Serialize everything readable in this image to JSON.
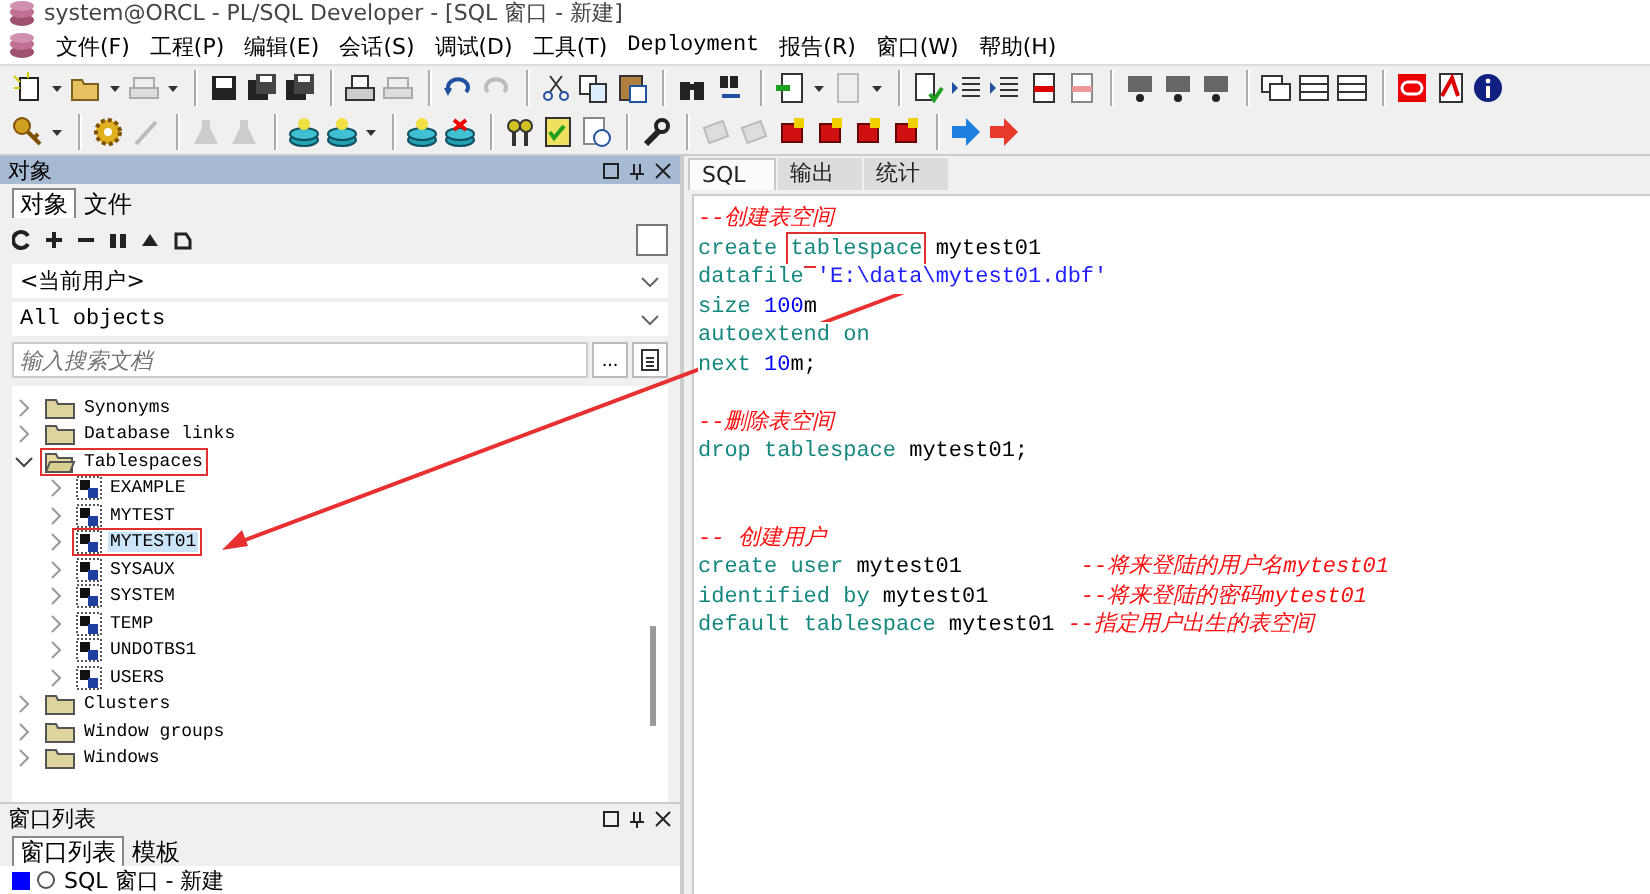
{
  "window": {
    "title": "system@ORCL - PL/SQL Developer - [SQL 窗口 - 新建]"
  },
  "menu": [
    "文件(F)",
    "工程(P)",
    "编辑(E)",
    "会话(S)",
    "调试(D)",
    "工具(T)",
    "Deployment",
    "报告(R)",
    "窗口(W)",
    "帮助(H)"
  ],
  "object_panel": {
    "title": "对象",
    "tabs": [
      {
        "label": "对象",
        "selected": true
      },
      {
        "label": "文件",
        "selected": false
      }
    ],
    "filter_checked": false,
    "owner_dropdown": "<当前用户>",
    "type_dropdown": "All objects",
    "search": {
      "placeholder": "输入搜索文档",
      "browse_button": "..."
    },
    "tree": [
      {
        "label": "Synonyms",
        "expanded": false,
        "highlighted": false,
        "selected": false,
        "kind": "folder"
      },
      {
        "label": "Database links",
        "expanded": false,
        "highlighted": false,
        "selected": false,
        "kind": "folder"
      },
      {
        "label": "Tablespaces",
        "expanded": true,
        "highlighted": true,
        "selected": false,
        "kind": "folder",
        "children": [
          {
            "label": "EXAMPLE",
            "expanded": false,
            "highlighted": false,
            "selected": false,
            "kind": "tablespace"
          },
          {
            "label": "MYTEST",
            "expanded": false,
            "highlighted": false,
            "selected": false,
            "kind": "tablespace"
          },
          {
            "label": "MYTEST01",
            "expanded": false,
            "highlighted": true,
            "selected": true,
            "kind": "tablespace"
          },
          {
            "label": "SYSAUX",
            "expanded": false,
            "highlighted": false,
            "selected": false,
            "kind": "tablespace"
          },
          {
            "label": "SYSTEM",
            "expanded": false,
            "highlighted": false,
            "selected": false,
            "kind": "tablespace"
          },
          {
            "label": "TEMP",
            "expanded": false,
            "highlighted": false,
            "selected": false,
            "kind": "tablespace"
          },
          {
            "label": "UNDOTBS1",
            "expanded": false,
            "highlighted": false,
            "selected": false,
            "kind": "tablespace"
          },
          {
            "label": "USERS",
            "expanded": false,
            "highlighted": false,
            "selected": false,
            "kind": "tablespace"
          }
        ]
      },
      {
        "label": "Clusters",
        "expanded": false,
        "highlighted": false,
        "selected": false,
        "kind": "folder"
      },
      {
        "label": "Window groups",
        "expanded": false,
        "highlighted": false,
        "selected": false,
        "kind": "folder"
      },
      {
        "label": "Windows",
        "expanded": false,
        "highlighted": false,
        "selected": false,
        "kind": "folder"
      }
    ]
  },
  "window_list_panel": {
    "title": "窗口列表",
    "tabs": [
      {
        "label": "窗口列表",
        "selected": true
      },
      {
        "label": "模板",
        "selected": false
      }
    ],
    "items": [
      "SQL 窗口 - 新建"
    ]
  },
  "editor": {
    "tabs": [
      {
        "label": "SQL",
        "selected": true
      },
      {
        "label": "输出",
        "selected": false
      },
      {
        "label": "统计",
        "selected": false
      }
    ],
    "lines": [
      {
        "tokens": [
          {
            "text": "--创建表空间",
            "kind": "comment"
          }
        ]
      },
      {
        "tokens": [
          {
            "text": "create",
            "kind": "keyword"
          },
          {
            "text": "tablespace",
            "kind": "keyword",
            "boxed": true
          },
          {
            "text": "mytest01",
            "kind": "plain"
          }
        ]
      },
      {
        "tokens": [
          {
            "text": "datafile",
            "kind": "keyword"
          },
          {
            "text": "'E:\\data\\mytest01.dbf'",
            "kind": "string"
          }
        ]
      },
      {
        "tokens": [
          {
            "text": "size",
            "kind": "keyword"
          },
          {
            "text": "100",
            "kind": "number"
          },
          {
            "text": "m",
            "kind": "plain"
          }
        ]
      },
      {
        "tokens": [
          {
            "text": "autoextend",
            "kind": "keyword"
          },
          {
            "text": "on",
            "kind": "keyword"
          }
        ]
      },
      {
        "tokens": [
          {
            "text": "next",
            "kind": "keyword"
          },
          {
            "text": "10",
            "kind": "number"
          },
          {
            "text": "m;",
            "kind": "plain"
          }
        ]
      },
      {
        "kind": "blank"
      },
      {
        "tokens": [
          {
            "text": "--删除表空间",
            "kind": "comment"
          }
        ]
      },
      {
        "tokens": [
          {
            "text": "drop",
            "kind": "keyword"
          },
          {
            "text": "tablespace",
            "kind": "keyword"
          },
          {
            "text": "mytest01;",
            "kind": "plain"
          }
        ]
      },
      {
        "kind": "blank"
      },
      {
        "kind": "blank"
      },
      {
        "tokens": [
          {
            "text": "-- 创建用户",
            "kind": "comment"
          }
        ]
      },
      {
        "tokens": [
          {
            "text": "create",
            "kind": "keyword"
          },
          {
            "text": "user",
            "kind": "keyword"
          },
          {
            "text": "mytest01",
            "kind": "plain"
          },
          {
            "text": "--将来登陆的用户名mytest01",
            "kind": "comment"
          }
        ]
      },
      {
        "tokens": [
          {
            "text": "identified",
            "kind": "keyword"
          },
          {
            "text": "by",
            "kind": "keyword"
          },
          {
            "text": "mytest01",
            "kind": "plain"
          },
          {
            "text": "--将来登陆的密码mytest01",
            "kind": "comment"
          }
        ]
      },
      {
        "tokens": [
          {
            "text": "default",
            "kind": "keyword"
          },
          {
            "text": "tablespace",
            "kind": "keyword"
          },
          {
            "text": "mytest01",
            "kind": "plain"
          },
          {
            "text": "--指定用户出生的表空间",
            "kind": "comment"
          }
        ]
      }
    ]
  }
}
